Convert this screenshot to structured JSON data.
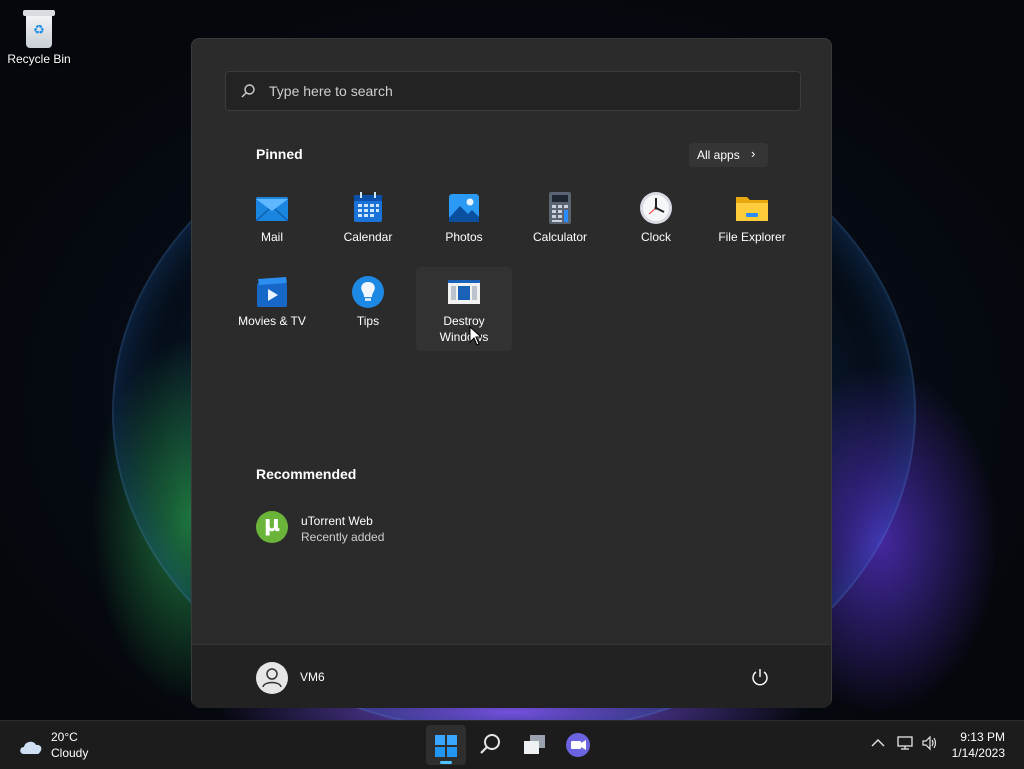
{
  "desktop": {
    "recycle_bin_label": "Recycle Bin"
  },
  "start_menu": {
    "search_placeholder": "Type here to search",
    "pinned_title": "Pinned",
    "all_apps_label": "All apps",
    "pinned_apps": [
      {
        "label": "Mail",
        "icon": "mail-icon"
      },
      {
        "label": "Calendar",
        "icon": "calendar-icon"
      },
      {
        "label": "Photos",
        "icon": "photos-icon"
      },
      {
        "label": "Calculator",
        "icon": "calculator-icon"
      },
      {
        "label": "Clock",
        "icon": "clock-icon"
      },
      {
        "label": "File Explorer",
        "icon": "file-explorer-icon"
      },
      {
        "label": "Movies & TV",
        "icon": "movies-tv-icon"
      },
      {
        "label": "Tips",
        "icon": "tips-icon"
      },
      {
        "label": "Destroy Windows",
        "icon": "destroy-windows-icon"
      }
    ],
    "recommended_title": "Recommended",
    "recommended": [
      {
        "name": "uTorrent Web",
        "subtitle": "Recently added",
        "icon": "utorrent-icon"
      }
    ],
    "user_name": "VM6"
  },
  "taskbar": {
    "weather": {
      "temp": "20°C",
      "condition": "Cloudy"
    },
    "time": "9:13 PM",
    "date": "1/14/2023"
  },
  "colors": {
    "accent": "#4cc2ff",
    "menu_bg": "#2b2b2b",
    "taskbar_bg": "#1c1c1c"
  }
}
